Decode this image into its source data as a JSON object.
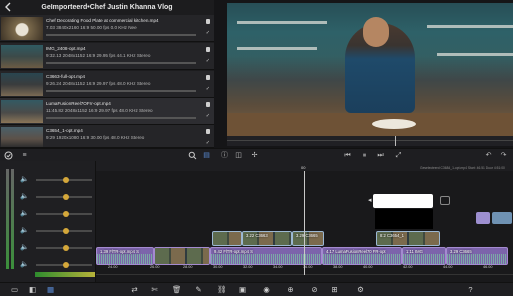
{
  "browser": {
    "title": "GeImporteerd•Chef Justin Khanna Vlog",
    "clips": [
      {
        "name": "Chef Decorating Food Plate at commercial kitchen.mp4",
        "info": "7.03 3840x2160 16:9 50.00 fps 0.0 KHz Nee",
        "selected": false
      },
      {
        "name": "IMG_2408-opt.mp4",
        "info": "9:32.13 2048x1152 16:9 29.95 fps 44.1 KHz Stereo",
        "selected": false
      },
      {
        "name": "C3663-full-opt.mp4",
        "info": "9:26.24 2048x1152 16:9 29.97 fps 48.0 KHz Stereo",
        "selected": false
      },
      {
        "name": "LumaFusionReel7OFrr-opt.mp4",
        "info": "11:45.82 2048x1152 16:9 29.97 fps 48.0 KHz Stereo",
        "selected": true
      },
      {
        "name": "C3654_1-opt.mp4",
        "info": "9:29 1920x1080 16:9 30.00 fps 48.0 KHz Stereo",
        "selected": false
      }
    ]
  },
  "timeline": {
    "info": "Geselecteerd C3684_1-opt.mp4 Start: 46.51 Duur 4:51:00",
    "marker": "00",
    "ruler_labels": [
      "24.00",
      "26.00",
      "28.00",
      "30.00",
      "32.00",
      "34.00",
      "36.00",
      "38.00",
      "40.00",
      "42.00",
      "44.00",
      "46.00"
    ],
    "clips": [
      {
        "label": "3.22 C3663",
        "kind": "video"
      },
      {
        "label": "3.29 C3665",
        "kind": "video"
      },
      {
        "label": "8:2 C3654_1",
        "kind": "video"
      },
      {
        "label": "1.39 FlTR-opt.mp4 S",
        "kind": "audio"
      },
      {
        "label": "9.42 FlTR-opt.mp4 S",
        "kind": "audio"
      },
      {
        "label": "4.17 LumaFusionReel70 FR-opt",
        "kind": "audio"
      },
      {
        "label": "1:11 IMG",
        "kind": "audio"
      },
      {
        "label": "3.29 C3665",
        "kind": "audio"
      }
    ]
  },
  "icons": {
    "left_toolbar": [
      "check-circle-icon",
      "menu-icon",
      "search-icon",
      "layers-icon"
    ],
    "viewer_toolbar": [
      "info-icon",
      "crop-icon",
      "transform-icon",
      "skip-back-icon",
      "play-icon",
      "skip-forward-icon",
      "fullscreen-icon",
      "undo-icon",
      "redo-icon"
    ],
    "bottom_bar": [
      "media-icon",
      "overwrite-icon",
      "grid-icon",
      "move-icon",
      "split-icon",
      "delete-icon",
      "edit-icon",
      "link-icon",
      "snapshot-icon",
      "marker-icon",
      "add-icon",
      "adjust-icon",
      "export-icon",
      "settings-icon",
      "help-icon"
    ]
  },
  "colors": {
    "video_clip": "#6f92b3",
    "audio_clip": "#7c64ab",
    "accent_gold": "#d4a73a"
  }
}
